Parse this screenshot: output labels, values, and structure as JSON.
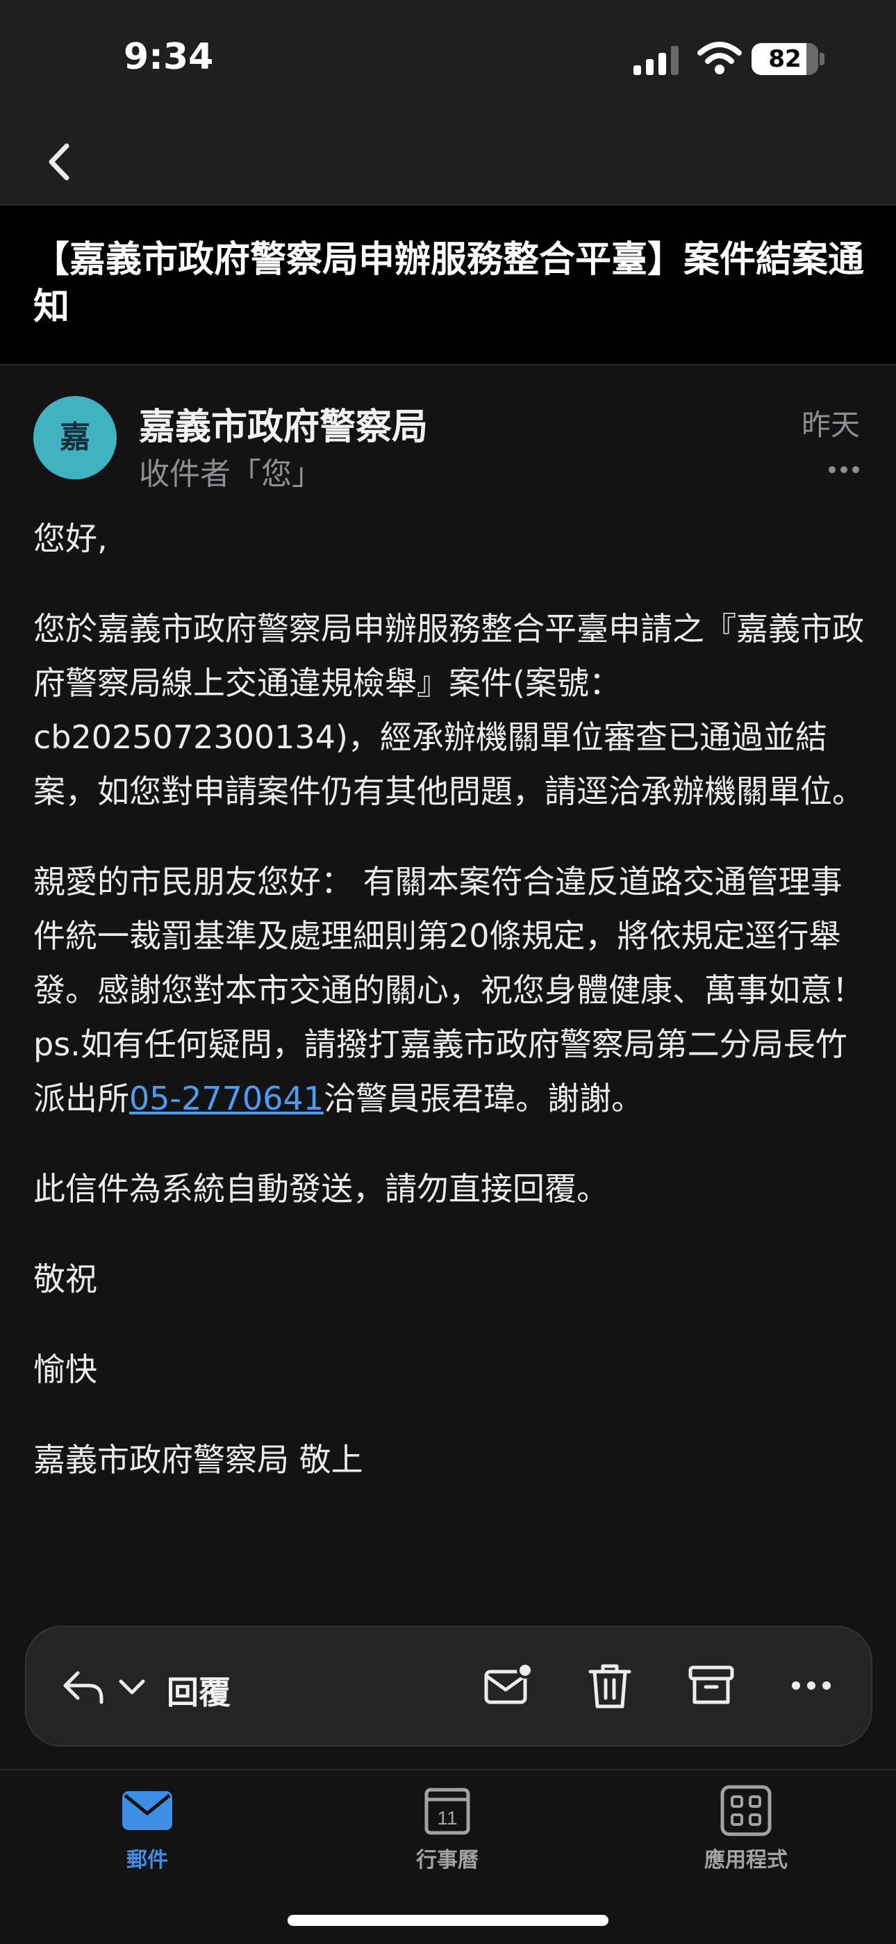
{
  "status": {
    "time": "9:34",
    "battery": "82"
  },
  "email": {
    "subject": "【嘉義市政府警察局申辦服務整合平臺】案件結案通知",
    "avatar_letter": "嘉",
    "sender": "嘉義市政府警察局",
    "recipient": "收件者「您」",
    "date": "昨天",
    "greeting": "您好,",
    "para1": "您於嘉義市政府警察局申辦服務整合平臺申請之『嘉義市政府警察局線上交通違規檢舉』案件(案號：cb2025072300134)，經承辦機關單位審查已通過並結案，如您對申請案件仍有其他問題，請逕洽承辦機關單位。",
    "para2_before": "親愛的市民朋友您好： 有關本案符合違反道路交通管理事件統一裁罰基準及處理細則第20條規定，將依規定逕行舉發。感謝您對本市交通的關心，祝您身體健康、萬事如意！ ps.如有任何疑問，請撥打嘉義市政府警察局第二分局長竹派出所",
    "para2_phone": "05-2770641",
    "para2_after": "洽警員張君瑋。謝謝。",
    "para3": "此信件為系統自動發送，請勿直接回覆。",
    "closing1": "敬祝",
    "closing2": "愉快",
    "signature": "嘉義市政府警察局 敬上"
  },
  "action_bar": {
    "reply_label": "回覆"
  },
  "tabs": [
    {
      "label": "郵件",
      "active": true
    },
    {
      "label": "行事曆",
      "calendar_day": "11"
    },
    {
      "label": "應用程式"
    }
  ],
  "colors": {
    "accent": "#3d8fe5",
    "link": "#4a9ff5",
    "avatar": "#3fb3c0"
  }
}
